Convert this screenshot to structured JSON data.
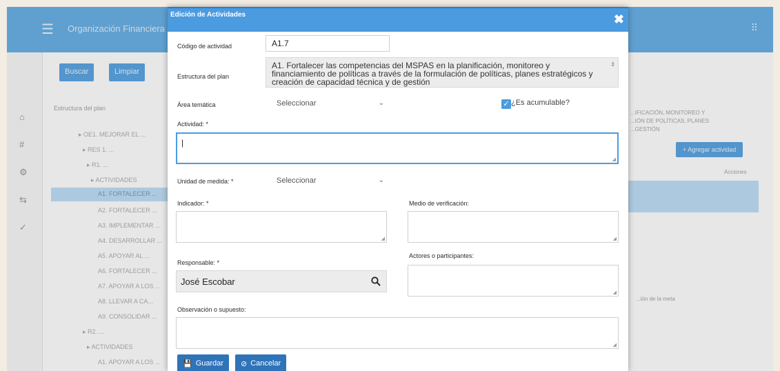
{
  "background": {
    "app_title": "Organización Financiera",
    "buttons": [
      "Buscar",
      "Limpiar"
    ],
    "tree_header": "Estructura del plan",
    "tree_items": [
      "▸ OE1. MEJORAR EL ...",
      "▸ RES 1. ...",
      "▸ R1. ...",
      "▸ ACTIVIDADES",
      "A1. FORTALECER ...",
      "A2. FORTALECER ...",
      "A3. IMPLEMENTAR ...",
      "A4. DESARROLLAR ...",
      "A5. APOYAR AL ...",
      "A6. FORTALECER ...",
      "A7. APOYAR A LOS ...",
      "A8. LLEVAR A CA...",
      "A9. CONSOLIDAR ...",
      "▸ R2. ...",
      "▸ ACTIVIDADES",
      "A1. APOYAR A LOS ..."
    ],
    "right_text": [
      "...IFICACIÓN, MONITOREO Y",
      "...IÓN DE POLÍTICAS, PLANES",
      "...GESTIÓN"
    ],
    "add_button": "+ Agregar actividad",
    "col_header": "Acciones",
    "right_footer": "...ión de la meta"
  },
  "modal": {
    "title": "Edición de Actividades",
    "codigo_label": "Código de actividad",
    "codigo_value": "A1.7",
    "estructura_label": "Estructura del plan",
    "estructura_text": "A1. Fortalecer las competencias del MSPAS en la planificación, monitoreo y financiamiento de políticas a través de la formulación de políticas, planes estratégicos y creación de capacidad técnica y de gestión",
    "area_label": "Área temática",
    "area_value": "Seleccionar",
    "acumulable_label": "¿Es acumulable?",
    "actividad_label": "Actividad: *",
    "actividad_value": "|",
    "unidad_label": "Unidad de medida: *",
    "unidad_value": "Seleccionar",
    "indicador_label": "Indicador: *",
    "medio_label": "Medio de verificación:",
    "responsable_label": "Responsable: *",
    "responsable_value": "José Escobar",
    "actores_label": "Actores o participantes:",
    "observacion_label": "Observación o supuesto:",
    "guardar_label": "Guardar",
    "cancelar_label": "Cancelar"
  },
  "colors": {
    "header": "#4b9be0",
    "button": "#2f73b8",
    "selected": "#b9dbf6"
  }
}
